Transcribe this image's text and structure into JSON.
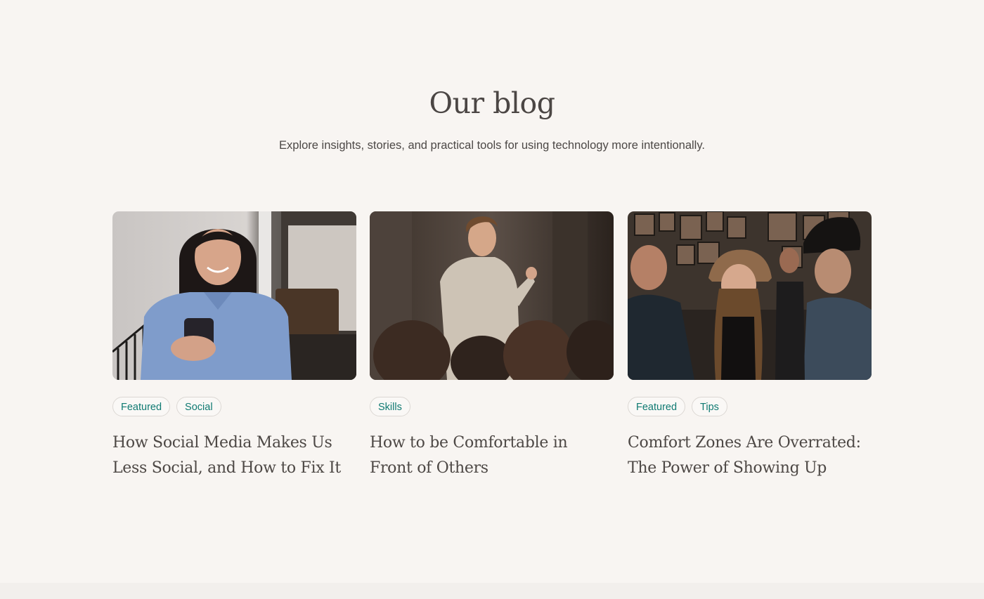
{
  "header": {
    "title": "Our blog",
    "subtitle": "Explore insights, stories, and practical tools for using technology more intentionally."
  },
  "posts": [
    {
      "image_icon": "woman-smiling-at-phone-photo",
      "tags": [
        "Featured",
        "Social"
      ],
      "title": "How Social Media Makes Us Less Social, and How to Fix It"
    },
    {
      "image_icon": "speaker-presenting-to-audience-photo",
      "tags": [
        "Skills"
      ],
      "title": "How to be Comfortable in Front of Others"
    },
    {
      "image_icon": "people-socializing-at-gallery-photo",
      "tags": [
        "Featured",
        "Tips"
      ],
      "title": "Comfort Zones Are Overrated: The Power of Showing Up"
    }
  ],
  "colors": {
    "background": "#f8f5f2",
    "tag_text": "#0f7a72",
    "tag_border": "#dcd8d4",
    "heading_text": "#4b4644"
  }
}
